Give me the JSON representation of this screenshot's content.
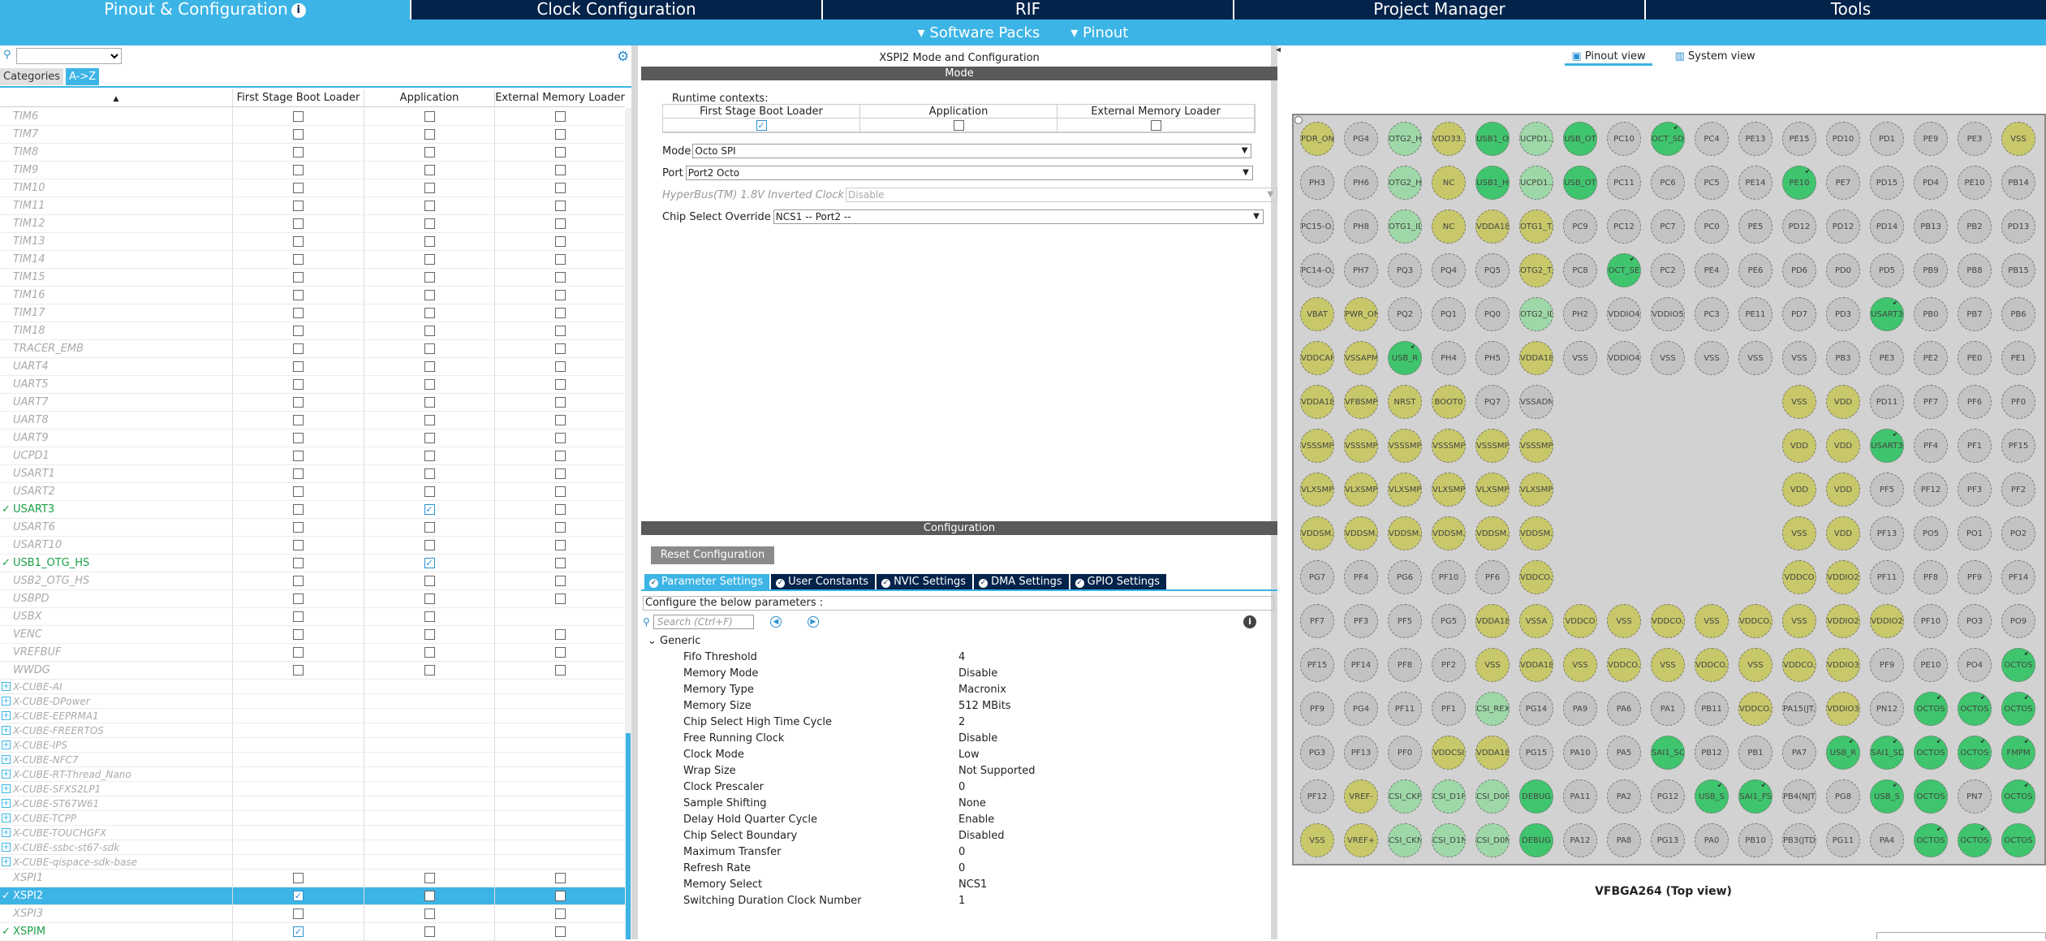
{
  "topnav": {
    "tabs": [
      {
        "label": "Pinout & Configuration",
        "active": true
      },
      {
        "label": "Clock Configuration"
      },
      {
        "label": "RIF"
      },
      {
        "label": "Project Manager"
      },
      {
        "label": "Tools"
      }
    ]
  },
  "subnav": {
    "software_packs": "Software Packs",
    "pinout": "Pinout"
  },
  "left": {
    "categories_label": "Categories",
    "az_label": "A->Z",
    "columns": [
      "First Stage Boot Loader",
      "Application",
      "External Memory Loader"
    ],
    "rows": [
      {
        "name": "TIM6",
        "c": [
          0,
          0,
          0
        ],
        "em": true
      },
      {
        "name": "TIM7",
        "c": [
          0,
          0,
          0
        ],
        "em": true
      },
      {
        "name": "TIM8",
        "c": [
          0,
          0,
          0
        ],
        "em": true
      },
      {
        "name": "TIM9",
        "c": [
          0,
          0,
          0
        ],
        "em": true
      },
      {
        "name": "TIM10",
        "c": [
          0,
          0,
          0
        ],
        "em": true
      },
      {
        "name": "TIM11",
        "c": [
          0,
          0,
          0
        ],
        "em": true
      },
      {
        "name": "TIM12",
        "c": [
          0,
          0,
          0
        ],
        "em": true
      },
      {
        "name": "TIM13",
        "c": [
          0,
          0,
          0
        ],
        "em": true
      },
      {
        "name": "TIM14",
        "c": [
          0,
          0,
          0
        ],
        "em": true
      },
      {
        "name": "TIM15",
        "c": [
          0,
          0,
          0
        ],
        "em": true
      },
      {
        "name": "TIM16",
        "c": [
          0,
          0,
          0
        ],
        "em": true
      },
      {
        "name": "TIM17",
        "c": [
          0,
          0,
          0
        ],
        "em": true
      },
      {
        "name": "TIM18",
        "c": [
          0,
          0,
          0
        ],
        "em": true
      },
      {
        "name": "TRACER_EMB",
        "c": [
          0,
          0,
          0
        ],
        "em": true
      },
      {
        "name": "UART4",
        "c": [
          0,
          0,
          0
        ],
        "em": true
      },
      {
        "name": "UART5",
        "c": [
          0,
          0,
          0
        ],
        "em": true
      },
      {
        "name": "UART7",
        "c": [
          0,
          0,
          0
        ],
        "em": true
      },
      {
        "name": "UART8",
        "c": [
          0,
          0,
          0
        ],
        "em": true
      },
      {
        "name": "UART9",
        "c": [
          0,
          0,
          0
        ],
        "em": true
      },
      {
        "name": "UCPD1",
        "c": [
          0,
          0,
          0
        ],
        "em": true
      },
      {
        "name": "USART1",
        "c": [
          0,
          0,
          0
        ],
        "em": true
      },
      {
        "name": "USART2",
        "c": [
          0,
          0,
          0
        ],
        "em": true
      },
      {
        "name": "USART3",
        "c": [
          0,
          1,
          0
        ],
        "em": true,
        "on": true
      },
      {
        "name": "USART6",
        "c": [
          0,
          0,
          0
        ],
        "em": true
      },
      {
        "name": "USART10",
        "c": [
          0,
          0,
          0
        ],
        "em": true
      },
      {
        "name": "USB1_OTG_HS",
        "c": [
          0,
          1,
          0
        ],
        "em": true,
        "on": true
      },
      {
        "name": "USB2_OTG_HS",
        "c": [
          0,
          0,
          0
        ],
        "em": true
      },
      {
        "name": "USBPD",
        "c": [
          0,
          0,
          0
        ],
        "em": true
      },
      {
        "name": "USBX",
        "c": [
          0,
          0,
          0
        ],
        "em": false
      },
      {
        "name": "VENC",
        "c": [
          0,
          0,
          0
        ],
        "em": true
      },
      {
        "name": "VREFBUF",
        "c": [
          0,
          0,
          0
        ],
        "em": true
      },
      {
        "name": "WWDG",
        "c": [
          0,
          0,
          0
        ],
        "em": true
      }
    ],
    "cubes": [
      "X-CUBE-AI",
      "X-CUBE-DPower",
      "X-CUBE-EEPRMA1",
      "X-CUBE-FREERTOS",
      "X-CUBE-IPS",
      "X-CUBE-NFC7",
      "X-CUBE-RT-Thread_Nano",
      "X-CUBE-SFXS2LP1",
      "X-CUBE-ST67W61",
      "X-CUBE-TCPP",
      "X-CUBE-TOUCHGFX",
      "X-CUBE-ssbc-st67-sdk",
      "X-CUBE-qispace-sdk-base"
    ],
    "tail": [
      {
        "name": "XSPI1",
        "c": [
          0,
          0,
          0
        ]
      },
      {
        "name": "XSPI2",
        "c": [
          1,
          0,
          0
        ],
        "sel": true
      },
      {
        "name": "XSPI3",
        "c": [
          0,
          0,
          0
        ]
      },
      {
        "name": "XSPIM",
        "c": [
          1,
          0,
          0
        ],
        "on": true
      }
    ]
  },
  "mid": {
    "title": "XSPI2 Mode and Configuration",
    "mode_bar": "Mode",
    "runtime_label": "Runtime contexts:",
    "ctx": [
      "First Stage Boot Loader",
      "Application",
      "External Memory Loader"
    ],
    "ctx_checked": [
      true,
      false,
      false
    ],
    "mode_label": "Mode",
    "mode_value": "Octo SPI",
    "port_label": "Port",
    "port_value": "Port2 Octo",
    "hyper_label": "HyperBus(TM) 1.8V Inverted Clock",
    "hyper_value": "Disable",
    "cso_label": "Chip Select Override",
    "cso_value": "NCS1 -- Port2 --",
    "config_bar": "Configuration",
    "reset_label": "Reset Configuration",
    "ptabs": [
      "Parameter Settings",
      "User Constants",
      "NVIC Settings",
      "DMA Settings",
      "GPIO Settings"
    ],
    "configure_text": "Configure the below parameters :",
    "search_placeholder": "Search (Ctrl+F)",
    "generic_label": "Generic",
    "params": [
      [
        "Fifo Threshold",
        "4"
      ],
      [
        "Memory Mode",
        "Disable"
      ],
      [
        "Memory Type",
        "Macronix"
      ],
      [
        "Memory Size",
        "512 MBits"
      ],
      [
        "Chip Select High Time Cycle",
        "2"
      ],
      [
        "Free Running Clock",
        "Disable"
      ],
      [
        "Clock Mode",
        "Low"
      ],
      [
        "Wrap Size",
        "Not Supported"
      ],
      [
        "Clock Prescaler",
        "0"
      ],
      [
        "Sample Shifting",
        "None"
      ],
      [
        "Delay Hold Quarter Cycle",
        "Enable"
      ],
      [
        "Chip Select Boundary",
        "Disabled"
      ],
      [
        "Maximum Transfer",
        "0"
      ],
      [
        "Refresh Rate",
        "0"
      ],
      [
        "Memory Select",
        "NCS1"
      ],
      [
        "Switching Duration Clock Number",
        "1"
      ]
    ]
  },
  "right": {
    "pinout_view": "Pinout view",
    "system_view": "System view",
    "package": "VFBGA264 (Top view)",
    "pins": [
      [
        "PDR_ON:y",
        "PG4",
        "OTG2_H:lg",
        "VDD33...:y",
        "USB1_O:g",
        "UCPD1...:lg",
        "USB_OT:g",
        "PC10",
        "OCT_SD:g:t",
        "PC4",
        "PE13",
        "PE15",
        "PD10",
        "PD1",
        "PE9",
        "PE3",
        "VSS:y"
      ],
      [
        "PH3",
        "PH6",
        "OTG2_H:lg",
        "NC:y",
        "USB1_H:g",
        "UCPD1...:lg",
        "USB_OT:g",
        "PC11",
        "PC6",
        "PC5",
        "PE14",
        "PE10:g:t",
        "PE7",
        "PD15",
        "PD4",
        "PE10",
        "PB14"
      ],
      [
        "PC15-O...",
        "PH8",
        "OTG1_ID:lg",
        "NC:y",
        "VDDA18...:y",
        "OTG1_T...:y",
        "PC9",
        "PC12",
        "PC7",
        "PC0",
        "PE5",
        "PD12",
        "PD12",
        "PD14",
        "PB13",
        "PB2",
        "PD13"
      ],
      [
        "PC14-O...",
        "PH7",
        "PQ3",
        "PQ4",
        "PQ5",
        "OTG2_T...:y",
        "PC8",
        "OCT_SE:g:t",
        "PC2",
        "PE4",
        "PE6",
        "PD6",
        "PD0",
        "PD5",
        "PB9",
        "PB8",
        "PB15"
      ],
      [
        "VBAT:y",
        "PWR_ON:y",
        "PQ2",
        "PQ1",
        "PQ0",
        "OTG2_ID:lg",
        "PH2",
        "VDDIO4",
        "VDDIO5",
        "PC3",
        "PE11",
        "PD7",
        "PD3",
        "USART3:g:t",
        "PB0",
        "PB7",
        "PB6"
      ],
      [
        "VDDCAP:y",
        "VSSAPM...:y",
        "USB_R:g:t",
        "PH4",
        "PH5",
        "VDDA18...:y",
        "VSS",
        "VDDIO4",
        "VSS",
        "VSS",
        "VSS",
        "VSS",
        "PB3",
        "PE3",
        "PE2",
        "PE0",
        "PE1"
      ],
      [
        "VDDA18...:y",
        "VFBSMPS:y",
        "NRST:y",
        "BOOT0:y",
        "PQ7",
        "VSSADN",
        "",
        "",
        "",
        "",
        "",
        "VSS:y",
        "VDD:y",
        "PD11",
        "PF7",
        "PF6",
        "PF0"
      ],
      [
        "VSSSMPS:y",
        "VSSSMPS:y",
        "VSSSMPS:y",
        "VSSSMPS:y",
        "VSSSMPS:y",
        "VSSSMPS:y",
        "",
        "",
        "",
        "",
        "",
        "VDD:y",
        "VDD:y",
        "USART3:g:t",
        "PF4",
        "PF1",
        "PF15"
      ],
      [
        "VLXSMPS:y",
        "VLXSMPS:y",
        "VLXSMPS:y",
        "VLXSMPS:y",
        "VLXSMPS:y",
        "VLXSMPS:y",
        "",
        "",
        "",
        "",
        "",
        "VDD:y",
        "VDD:y",
        "PF5",
        "PF12",
        "PF3",
        "PF2"
      ],
      [
        "VDDSM...:y",
        "VDDSM...:y",
        "VDDSM...:y",
        "VDDSM...:y",
        "VDDSM...:y",
        "VDDSM...:y",
        "",
        "",
        "",
        "",
        "",
        "VSS:y",
        "VDD:y",
        "PF13",
        "PO5",
        "PO1",
        "PO2"
      ],
      [
        "PG7",
        "PF4",
        "PG6",
        "PF10",
        "PF6",
        "VDDCO...:y",
        "",
        "",
        "",
        "",
        "",
        "VDDCO:y",
        "VDDIO2:y",
        "PF11",
        "PF8",
        "PF9",
        "PF14"
      ],
      [
        "PF7",
        "PF3",
        "PF5",
        "PG5",
        "VDDA18:y",
        "VSSA:y",
        "VDDCO:y",
        "VSS:y",
        "VDDCO...:y",
        "VSS:y",
        "VDDCO...:y",
        "VSS:y",
        "VDDIO2:y",
        "VDDIO2:y",
        "PF10",
        "PO3",
        "PO9"
      ],
      [
        "PF15",
        "PF14",
        "PF8",
        "PF2",
        "VSS:y",
        "VDDA18:y",
        "VSS:y",
        "VDDCO...:y",
        "VSS:y",
        "VDDCO...:y",
        "VSS:y",
        "VDDCO...:y",
        "VDDIO3:y",
        "PF9",
        "PE10",
        "PO4",
        "OCTOS:g:t"
      ],
      [
        "PF9",
        "PG4",
        "PF11",
        "PF1",
        "CSI_REXT:lg",
        "PG14",
        "PA9",
        "PA6",
        "PA1",
        "PB11",
        "VDDCO...:y",
        "PA15(JT...",
        "VDDIO3:y",
        "PN12",
        "OCTOS:g:t",
        "OCTOS:g:t",
        "OCTOS:g:t"
      ],
      [
        "PG3",
        "PF13",
        "PF0",
        "VDDCSI:y",
        "VDDA18:y",
        "PG15",
        "PA10",
        "PA5",
        "SAI1_SC:g",
        "PB12",
        "PB1",
        "PA7",
        "USB_R:g:t",
        "SAI1_SD:g:t",
        "OCTOS:g:t",
        "OCTOS:g:t",
        "FMPM:g:t"
      ],
      [
        "PF12",
        "VREF-:y",
        "CSI_CKP:lg",
        "CSI_D1P:lg",
        "CSI_D0P:lg",
        "DEBUG:g",
        "PA11",
        "PA2",
        "PG12",
        "USB_S:g:t",
        "SAI1_FS:g:t",
        "PB4(NJT...",
        "PG8",
        "USB_S:g:t",
        "OCTOS:g",
        "PN7",
        "OCTOS:g:t"
      ],
      [
        "VSS:y",
        "VREF+:y",
        "CSI_CKN:lg",
        "CSI_D1N:lg",
        "CSI_D0N:lg",
        "DEBUG:g",
        "PA12",
        "PA8",
        "PG13",
        "PA0",
        "PB10",
        "PB3(JTD...",
        "PG11",
        "PA4",
        "OCTOS:g:t",
        "OCTOS:g:t",
        "OCTOS:g"
      ]
    ]
  }
}
